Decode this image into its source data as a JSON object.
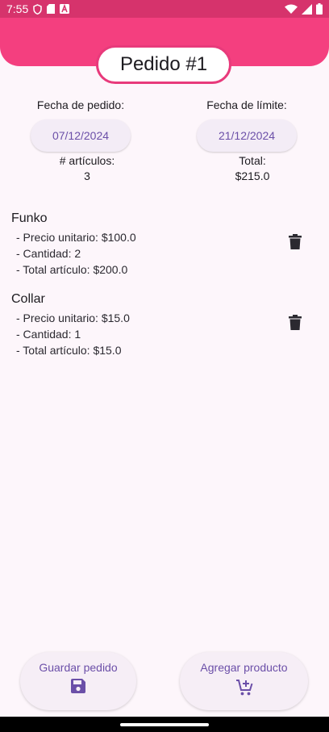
{
  "status_bar": {
    "time": "7:55",
    "left_icons": [
      "shield-icon",
      "sd-card-icon",
      "font-a-icon"
    ],
    "right_icons": [
      "wifi-icon",
      "signal-icon",
      "battery-icon"
    ]
  },
  "header": {
    "title": "Pedido #1",
    "color": "#f43f7f"
  },
  "order": {
    "order_date_label": "Fecha de pedido:",
    "order_date_value": "07/12/2024",
    "limit_date_label": "Fecha de límite:",
    "limit_date_value": "21/12/2024",
    "items_count_label": "# artículos:",
    "items_count_value": "3",
    "total_label": "Total:",
    "total_value": "$215.0"
  },
  "items": [
    {
      "name": "Funko",
      "unit_price": "- Precio unitario: $100.0",
      "quantity": "- Cantidad: 2",
      "total": "- Total artículo: $200.0"
    },
    {
      "name": "Collar",
      "unit_price": "- Precio unitario: $15.0",
      "quantity": "- Cantidad: 1",
      "total": "- Total artículo: $15.0"
    }
  ],
  "actions": {
    "save_label": "Guardar pedido",
    "add_label": "Agregar producto",
    "accent": "#6b4fa8"
  }
}
